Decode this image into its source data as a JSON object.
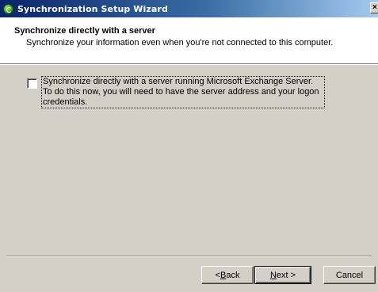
{
  "window": {
    "title": "Synchronization Setup Wizard",
    "close_glyph": "×"
  },
  "header": {
    "title": "Synchronize directly with a server",
    "subtitle": "Synchronize your information even when you're not connected to this computer."
  },
  "option": {
    "checked": false,
    "label": "Synchronize directly with a server running Microsoft Exchange Server.  To do this now, you will need to have the server address and your logon credentials."
  },
  "buttons": {
    "back": {
      "prefix": "< ",
      "accel": "B",
      "rest": "ack"
    },
    "next": {
      "prefix": "",
      "accel": "N",
      "rest": "ext >"
    },
    "cancel": {
      "label": "Cancel"
    }
  },
  "colors": {
    "face": "#d4d0c8",
    "title_start": "#0a246a",
    "title_end": "#a6caf0"
  }
}
